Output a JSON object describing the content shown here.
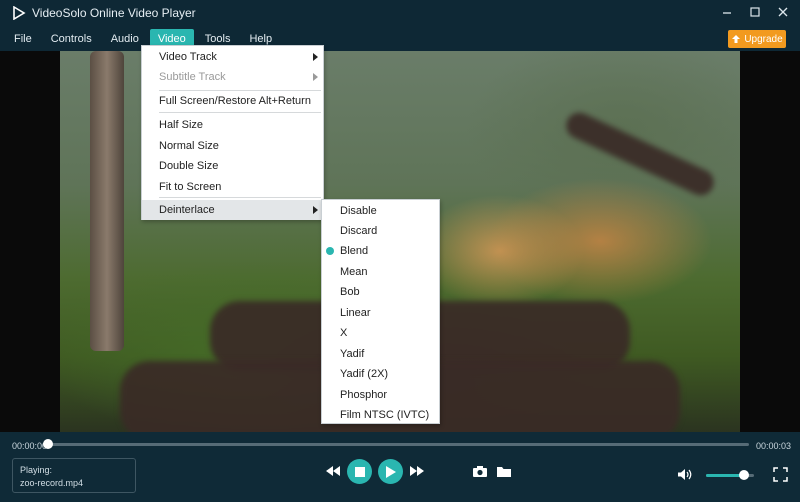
{
  "window": {
    "title": "VideoSolo Online Video Player",
    "controls": [
      "minimize-icon",
      "restore-icon",
      "close-icon"
    ]
  },
  "menubar": {
    "items": [
      "File",
      "Controls",
      "Audio",
      "Video",
      "Tools",
      "Help"
    ],
    "active": "Video",
    "upgrade_label": "Upgrade"
  },
  "video_menu": {
    "video_track": "Video Track",
    "subtitle_track": "Subtitle Track",
    "full_screen": "Full Screen/Restore Alt+Return",
    "half_size": "Half Size",
    "normal_size": "Normal Size",
    "double_size": "Double Size",
    "fit_to_screen": "Fit to Screen",
    "deinterlace": "Deinterlace"
  },
  "deinterlace_menu": {
    "items": [
      "Disable",
      "Discard",
      "Blend",
      "Mean",
      "Bob",
      "Linear",
      "X",
      "Yadif",
      "Yadif (2X)",
      "Phosphor",
      "Film NTSC (IVTC)"
    ],
    "selected": "Blend"
  },
  "playback": {
    "current_time": "00:00:00",
    "total_time": "00:00:03",
    "progress": 0.0,
    "playing_label": "Playing:",
    "file_name": "zoo-record.mp4",
    "volume": 0.8
  },
  "colors": {
    "accent": "#2ab6b0",
    "upgrade": "#f29a1f",
    "background": "#0f2a37"
  }
}
